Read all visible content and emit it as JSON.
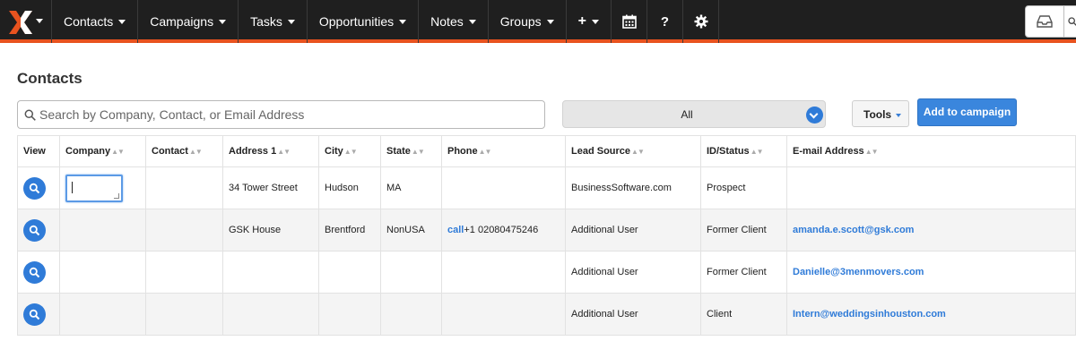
{
  "nav": {
    "items": [
      {
        "label": "Contacts",
        "dropdown": true
      },
      {
        "label": "Campaigns",
        "dropdown": true
      },
      {
        "label": "Tasks",
        "dropdown": true
      },
      {
        "label": "Opportunities",
        "dropdown": true
      },
      {
        "label": "Notes",
        "dropdown": true
      },
      {
        "label": "Groups",
        "dropdown": true
      },
      {
        "label": "+",
        "dropdown": true
      }
    ],
    "icons": [
      "calendar-icon",
      "help-icon",
      "gear-icon",
      "inbox-icon"
    ],
    "help_label": "?"
  },
  "page": {
    "title": "Contacts"
  },
  "search": {
    "placeholder": "Search by Company, Contact, or Email Address"
  },
  "filter": {
    "value": "All"
  },
  "toolbar": {
    "tools_label": "Tools",
    "add_label": "Add to campaign"
  },
  "table": {
    "headers": [
      "View",
      "Company",
      "Contact",
      "Address 1",
      "City",
      "State",
      "Phone",
      "Lead Source",
      "ID/Status",
      "E-mail Address"
    ],
    "rows": [
      {
        "company": "",
        "contact": "",
        "address": "34 Tower Street",
        "city": "Hudson",
        "state": "MA",
        "phone_call": "",
        "phone": "",
        "lead": "BusinessSoftware.com",
        "status": "Prospect",
        "email": ""
      },
      {
        "company": "",
        "contact": "",
        "address": "GSK House",
        "city": "Brentford",
        "state": "NonUSA",
        "phone_call": "call",
        "phone": "+1 02080475246",
        "lead": "Additional User",
        "status": "Former Client",
        "email": "amanda.e.scott@gsk.com"
      },
      {
        "company": "",
        "contact": "",
        "address": "",
        "city": "",
        "state": "",
        "phone_call": "",
        "phone": "",
        "lead": "Additional User",
        "status": "Former Client",
        "email": "Danielle@3menmovers.com"
      },
      {
        "company": "",
        "contact": "",
        "address": "",
        "city": "",
        "state": "",
        "phone_call": "",
        "phone": "",
        "lead": "Additional User",
        "status": "Client",
        "email": "Intern@weddingsinhouston.com"
      }
    ]
  },
  "colors": {
    "accent": "#e8531f",
    "primary": "#2f7bd8",
    "nav_bg": "#1f1f1f"
  }
}
